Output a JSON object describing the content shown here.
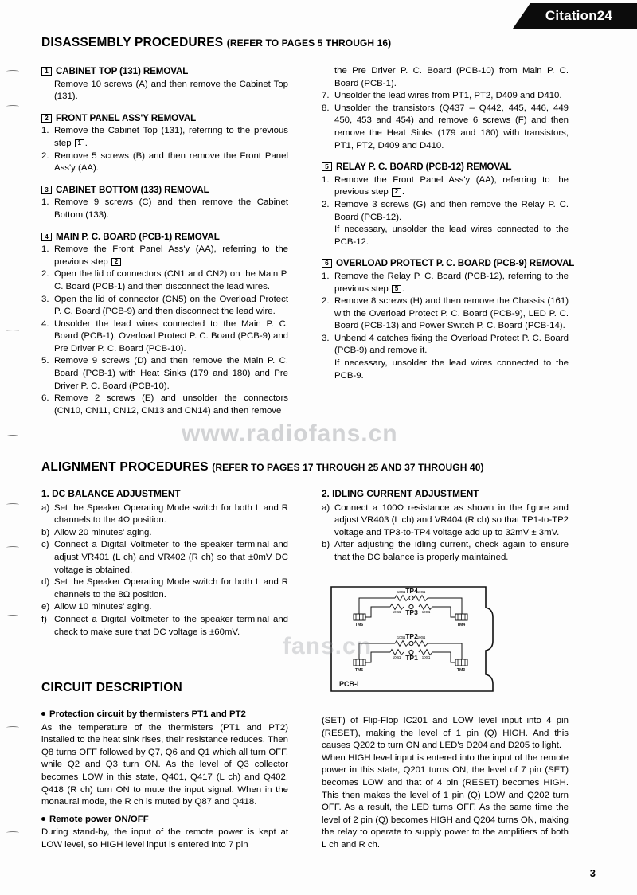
{
  "header": {
    "model_tab": "Citation24"
  },
  "page_number": "3",
  "watermark": {
    "text_1": "www.radiofans.cn",
    "text_2": "fans.cn"
  },
  "sections": {
    "disassembly": {
      "title": "DISASSEMBLY PROCEDURES",
      "subtitle": "(REFER TO PAGES 5 THROUGH 16)",
      "blocks_left": [
        {
          "num": "1",
          "title": "CABINET TOP (131) REMOVAL",
          "steps": [
            {
              "mark": "",
              "text": "Remove 10 screws (A) and then remove the Cabinet Top (131)."
            }
          ]
        },
        {
          "num": "2",
          "title": "FRONT PANEL ASS'Y REMOVAL",
          "steps": [
            {
              "mark": "1.",
              "text_pre": "Remove the Cabinet Top (131), referring to the previous step ",
              "box": "1",
              "text_post": "."
            },
            {
              "mark": "2.",
              "text": "Remove 5 screws (B) and then remove the Front Panel Ass'y (AA)."
            }
          ]
        },
        {
          "num": "3",
          "title": "CABINET BOTTOM (133) REMOVAL",
          "steps": [
            {
              "mark": "1.",
              "text": "Remove 9 screws (C) and then remove the Cabinet Bottom (133)."
            }
          ]
        },
        {
          "num": "4",
          "title": "MAIN P. C. BOARD (PCB-1) REMOVAL",
          "steps": [
            {
              "mark": "1.",
              "text_pre": "Remove the Front Panel Ass'y (AA), referring to the previous step ",
              "box": "2",
              "text_post": "."
            },
            {
              "mark": "2.",
              "text": "Open the lid of connectors (CN1 and CN2) on the Main P. C. Board (PCB-1) and then disconnect the lead wires."
            },
            {
              "mark": "3.",
              "text": "Open the lid of connector (CN5) on the Overload Protect P. C. Board (PCB-9) and then disconnect the lead wire."
            },
            {
              "mark": "4.",
              "text": "Unsolder the lead wires connected to the Main P. C. Board (PCB-1), Overload Protect P. C. Board (PCB-9) and Pre Driver P. C. Board (PCB-10)."
            },
            {
              "mark": "5.",
              "text": "Remove 9 screws (D) and then remove the Main P. C. Board (PCB-1) with Heat Sinks (179 and 180) and Pre Driver P. C. Board (PCB-10)."
            },
            {
              "mark": "6.",
              "text": "Remove 2 screws (E) and unsolder the connectors (CN10, CN11, CN12, CN13 and CN14) and then remove"
            }
          ]
        }
      ],
      "blocks_right": [
        {
          "num": "",
          "title": "",
          "steps": [
            {
              "mark": "",
              "text": "the Pre Driver P. C. Board (PCB-10) from Main P. C. Board (PCB-1)."
            },
            {
              "mark": "7.",
              "text": "Unsolder the lead wires from PT1, PT2, D409 and D410."
            },
            {
              "mark": "8.",
              "text": "Unsolder the transistors (Q437 – Q442, 445, 446, 449 450, 453 and 454) and remove 6 screws (F) and then remove the Heat Sinks (179 and 180) with transistors, PT1, PT2, D409 and D410."
            }
          ]
        },
        {
          "num": "5",
          "title": "RELAY P. C. BOARD (PCB-12) REMOVAL",
          "steps": [
            {
              "mark": "1.",
              "text_pre": "Remove the Front Panel Ass'y (AA), referring to the previous step ",
              "box": "2",
              "text_post": "."
            },
            {
              "mark": "2.",
              "text": "Remove 3 screws (G) and then remove the Relay P. C. Board (PCB-12)."
            },
            {
              "mark": "",
              "text": "If necessary, unsolder the lead wires connected to the PCB-12."
            }
          ]
        },
        {
          "num": "6",
          "title": "OVERLOAD PROTECT P. C. BOARD (PCB-9) REMOVAL",
          "steps": [
            {
              "mark": "1.",
              "text_pre": "Remove the Relay P. C. Board (PCB-12), referring to the previous step ",
              "box": "5",
              "text_post": "."
            },
            {
              "mark": "2.",
              "text": "Remove 8 screws (H) and then remove the Chassis (161) with the Overload Protect P. C. Board (PCB-9), LED P. C. Board (PCB-13) and Power Switch P. C. Board (PCB-14)."
            },
            {
              "mark": "3.",
              "text": "Unbend 4 catches fixing the Overload Protect P. C. Board (PCB-9) and remove it."
            },
            {
              "mark": "",
              "text": "If necessary, unsolder the lead wires connected to the PCB-9."
            }
          ]
        }
      ]
    },
    "alignment": {
      "title": "ALIGNMENT PROCEDURES",
      "subtitle": "(REFER TO PAGES 17 THROUGH 25 AND 37 THROUGH 40)",
      "left_title": "1. DC BALANCE ADJUSTMENT",
      "left_steps": [
        {
          "mark": "a)",
          "text": "Set the Speaker Operating Mode switch for both L and R channels to the 4Ω position."
        },
        {
          "mark": "b)",
          "text": "Allow 20 minutes' aging."
        },
        {
          "mark": "c)",
          "text": "Connect a Digital Voltmeter to the speaker terminal and adjust VR401 (L ch) and VR402 (R ch) so that ±0mV DC voltage is obtained."
        },
        {
          "mark": "d)",
          "text": "Set the Speaker Operating Mode switch for both L and R channels to the 8Ω position."
        },
        {
          "mark": "e)",
          "text": "Allow 10 minutes' aging."
        },
        {
          "mark": "f)",
          "text": "Connect a Digital Voltmeter to the speaker terminal and check to make sure that DC voltage is ±60mV."
        }
      ],
      "right_title": "2. IDLING CURRENT ADJUSTMENT",
      "right_steps": [
        {
          "mark": "a)",
          "text": "Connect a 100Ω resistance as shown in the figure and adjust VR403 (L ch) and VR404 (R ch) so that TP1-to-TP2 voltage and TP3-to-TP4 voltage add up to 32mV ± 3mV."
        },
        {
          "mark": "b)",
          "text": "After adjusting the idling current, check again to ensure that the DC balance is properly maintained."
        }
      ],
      "figure": {
        "board_label": "PCB-I",
        "test_points": [
          "TP4",
          "TP3",
          "TP2",
          "TP1"
        ],
        "terminals": [
          "TM6",
          "TM4",
          "TM5",
          "TM3"
        ],
        "resistor_values": [
          "100Ω",
          "100Ω",
          "100Ω",
          "100Ω",
          "100Ω",
          "100Ω",
          "100Ω",
          "100Ω"
        ]
      }
    },
    "circuit_description": {
      "title": "CIRCUIT DESCRIPTION",
      "left_items": [
        {
          "heading": "Protection circuit by thermisters PT1 and PT2",
          "paragraphs": [
            "As the temperature of the thermisters (PT1 and PT2) installed to the heat sink rises, their resistance reduces. Then Q8 turns OFF followed by Q7, Q6 and Q1 which all turn OFF, while Q2 and Q3 turn ON. As the level of Q3 collector becomes LOW in this state, Q401, Q417 (L ch) and Q402, Q418 (R ch) turn ON to mute the input signal. When in the monaural mode, the R ch is muted by Q87 and Q418."
          ]
        },
        {
          "heading": "Remote power ON/OFF",
          "paragraphs": [
            "During stand-by, the input of the remote power is kept at LOW level, so HIGH level input is entered into 7 pin"
          ]
        }
      ],
      "right_paragraphs": [
        "(SET) of Flip-Flop IC201 and LOW level input into 4 pin (RESET), making the level of 1 pin (Q) HIGH. And this causes Q202 to turn ON and LED's D204 and D205 to light.",
        "When HIGH level input is entered into the input of the remote power in this state, Q201 turns ON, the level of 7 pin (SET) becomes LOW and that of 4 pin (RESET) becomes HIGH. This then makes the level of 1 pin (Q) LOW and Q202 turn OFF. As a result, the LED turns OFF. As the same time the level of 2 pin (Q) becomes HIGH and Q204 turns ON, making the relay to operate to supply power to the amplifiers of both L ch and R ch."
      ]
    }
  }
}
